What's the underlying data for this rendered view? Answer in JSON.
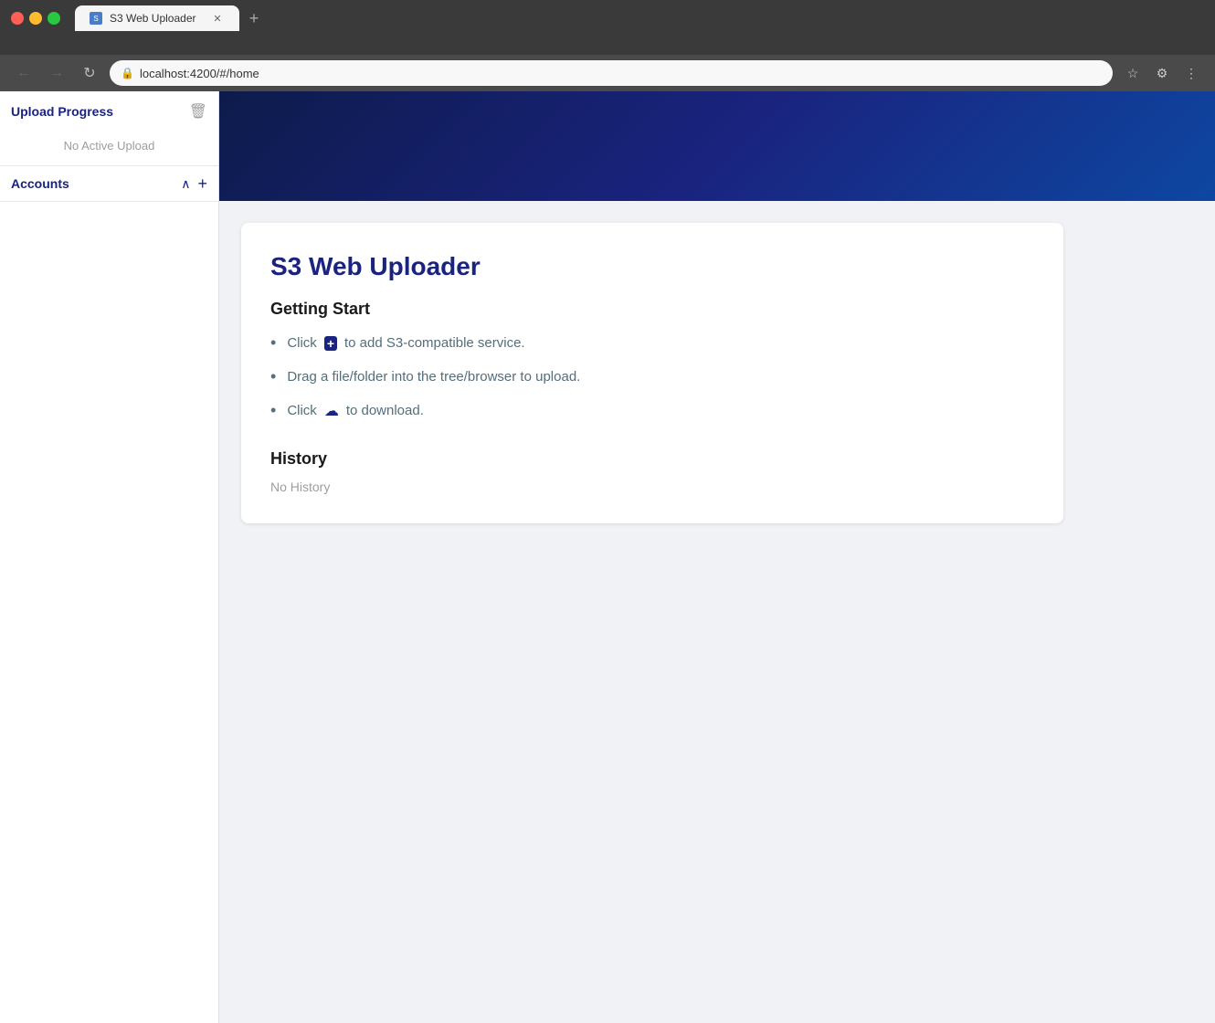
{
  "browser": {
    "tab_title": "S3 Web Uploader",
    "url": "localhost:4200/#/home",
    "new_tab_icon": "+",
    "back_disabled": true,
    "forward_disabled": true
  },
  "sidebar": {
    "upload_progress_label": "Upload Progress",
    "delete_icon_label": "🗑",
    "no_active_upload_label": "No Active Upload",
    "accounts_label": "Accounts",
    "chevron_label": "∧",
    "add_label": "+"
  },
  "main": {
    "app_title": "S3 Web Uploader",
    "getting_started_title": "Getting Start",
    "instruction_1_text": " to add S3-compatible service.",
    "instruction_1_prefix": "Click",
    "instruction_2_text": "Drag a file/folder into the tree/browser to upload.",
    "instruction_3_prefix": "Click",
    "instruction_3_text": " to download.",
    "history_title": "History",
    "no_history_label": "No History"
  }
}
